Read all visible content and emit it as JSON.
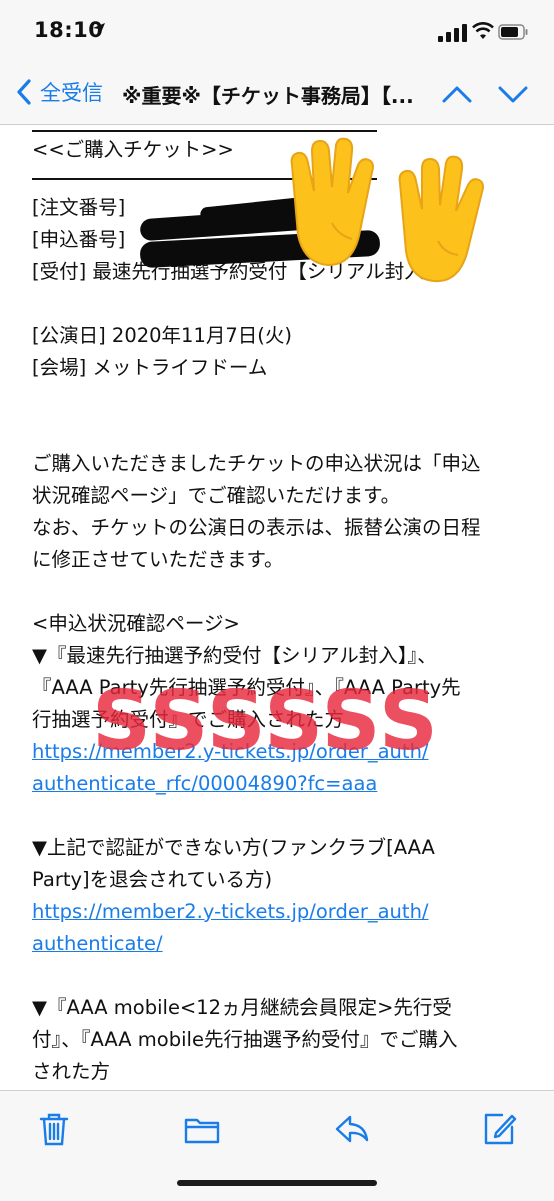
{
  "status_bar": {
    "time": "18:10"
  },
  "nav": {
    "back_label": "全受信",
    "title": "※重要※【チケット事務局】【..."
  },
  "email": {
    "ticket_header": "<<ご購入チケット>>",
    "order_number_label": "[注文番号]",
    "application_number_label": "[申込番号]",
    "reception": "[受付] 最速先行抽選予約受付【シリアル封入】",
    "performance_date": "[公演日] 2020年11月7日(火)",
    "venue": "[会場] メットライフドーム",
    "para1_line1": "ご購入いただきましたチケットの申込状況は「申込",
    "para1_line2": "状況確認ページ」でご確認いただけます。",
    "para1_line3": "なお、チケットの公演日の表示は、振替公演の日程",
    "para1_line4": "に修正させていただきます。",
    "status_page_header": "<申込状況確認ページ>",
    "s1_line1": "▼『最速先行抽選予約受付【シリアル封入】』、",
    "s1_line2": "『AAA Party先行抽選予約受付』、『AAA Party先",
    "s1_line3": "行抽選予約受付』でご購入された方",
    "link1_line1": "https://member2.y-tickets.jp/order_auth/",
    "link1_line2": "authenticate_rfc/00004890?fc=aaa",
    "s2_line1": "▼上記で認証ができない方(ファンクラブ[AAA",
    "s2_line2": "Party]を退会されている方)",
    "link2_line1": "https://member2.y-tickets.jp/order_auth/",
    "link2_line2": "authenticate/",
    "s3_line1": "▼『AAA mobile<12ヵ月継続会員限定>先行受",
    "s3_line2": "付』、『AAA mobile先行抽選予約受付』でご購入",
    "s3_line3": "された方"
  },
  "overlay": {
    "stamp_text": "SSSSSS"
  },
  "toolbar": {
    "trash_icon": "trash-icon",
    "folder_icon": "folder-icon",
    "reply_icon": "reply-icon",
    "compose_icon": "compose-icon"
  },
  "colors": {
    "accent": "#1a7ce8",
    "stamp": "#e8283c",
    "bar_bg": "#f7f7f7"
  }
}
